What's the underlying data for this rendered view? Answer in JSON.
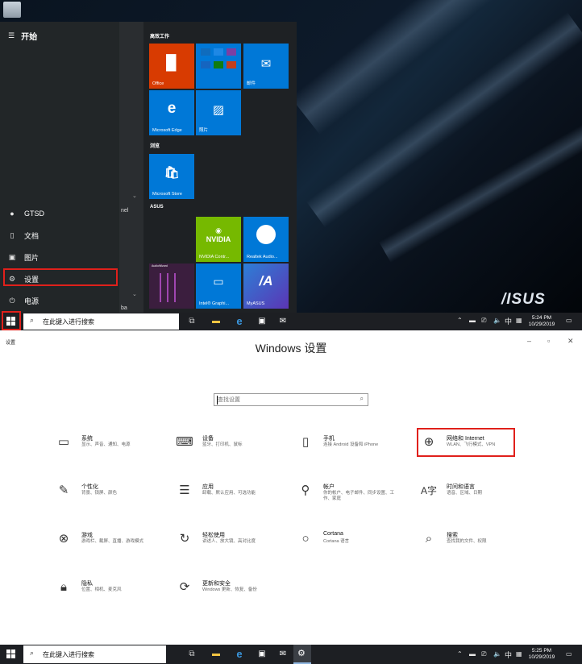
{
  "desktop": {
    "brand": "/ISUS"
  },
  "start_menu": {
    "header": "开始",
    "hamburger_icon": "hamburger-icon",
    "left_items": [
      {
        "icon": "user-icon",
        "label": "GTSD"
      },
      {
        "icon": "document-icon",
        "label": "文档"
      },
      {
        "icon": "picture-icon",
        "label": "图片"
      },
      {
        "icon": "gear-icon",
        "label": "设置"
      },
      {
        "icon": "power-icon",
        "label": "电源"
      }
    ],
    "partial_texts": [
      "nel",
      "ba"
    ],
    "groups": [
      "高效工作",
      "浏览",
      "ASUS"
    ],
    "tiles": {
      "office": "Office",
      "mail": "邮件",
      "edge": "Microsoft Edge",
      "photos": "照片",
      "store": "Microsoft Store",
      "nvidia": "NVIDIA Contr...",
      "realtek": "Realtek Audio...",
      "intel": "Intel® Graphi...",
      "myasus": "MyASUS",
      "audiowizard_title": "AudioWizard"
    },
    "tile_colors": {
      "blue": "#0078d7",
      "office": "#d83b01",
      "nvidia": "#76b900"
    }
  },
  "taskbar_top": {
    "search_placeholder": "在此键入进行搜索",
    "ime": "中",
    "time": "5:24 PM",
    "date": "10/29/2019"
  },
  "settings": {
    "window_title": "设置",
    "page_title": "Windows 设置",
    "search_placeholder": "查找设置",
    "categories": [
      {
        "icon": "laptop-icon",
        "name": "系统",
        "desc": "显示、声音、通知、电源"
      },
      {
        "icon": "keyboard-icon",
        "name": "设备",
        "desc": "蓝牙、打印机、鼠标"
      },
      {
        "icon": "phone-icon",
        "name": "手机",
        "desc": "连接 Android 设备和 iPhone"
      },
      {
        "icon": "globe-icon",
        "name": "网络和 Internet",
        "desc": "WLAN、飞行模式、VPN"
      },
      {
        "icon": "paintbrush-icon",
        "name": "个性化",
        "desc": "背景、锁屏、颜色"
      },
      {
        "icon": "apps-icon",
        "name": "应用",
        "desc": "卸载、默认应用、可选功能"
      },
      {
        "icon": "person-icon",
        "name": "帐户",
        "desc": "你的帐户、电子邮件、同步设置、工作、家庭"
      },
      {
        "icon": "time-language-icon",
        "name": "时间和语言",
        "desc": "语音、区域、日期"
      },
      {
        "icon": "xbox-icon",
        "name": "游戏",
        "desc": "游戏栏、截屏、直播、游戏模式"
      },
      {
        "icon": "ease-of-access-icon",
        "name": "轻松使用",
        "desc": "讲述人、放大镜、高对比度"
      },
      {
        "icon": "cortana-icon",
        "name": "Cortana",
        "desc": "Cortana 语言"
      },
      {
        "icon": "search-icon",
        "name": "搜索",
        "desc": "查找我的文件、权限"
      },
      {
        "icon": "lock-icon",
        "name": "隐私",
        "desc": "位置、相机、麦克风"
      },
      {
        "icon": "update-icon",
        "name": "更新和安全",
        "desc": "Windows 更新、恢复、备份"
      }
    ]
  },
  "taskbar_bottom": {
    "search_placeholder": "在此键入进行搜索",
    "ime": "中",
    "time": "5:25 PM",
    "date": "10/29/2019"
  },
  "highlight_color": "#e0201b"
}
